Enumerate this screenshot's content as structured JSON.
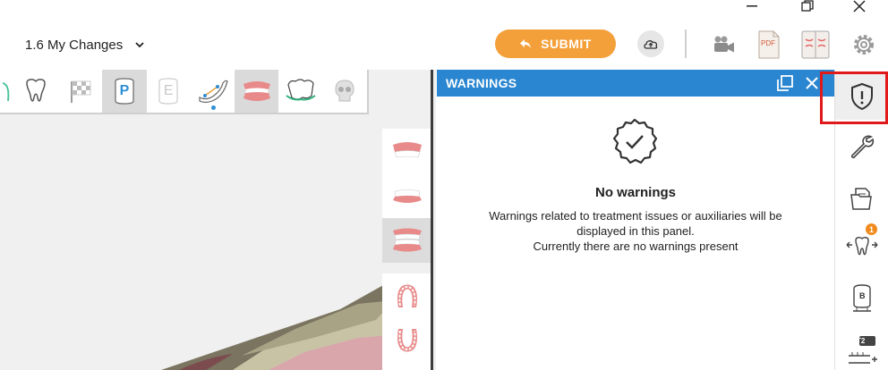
{
  "header": {
    "version_label": "1.6 My Changes",
    "submit_label": "SUBMIT",
    "pdf_label": "PDF"
  },
  "window_controls": [
    "minimize",
    "restore",
    "close"
  ],
  "toolbar": {
    "tools": [
      {
        "name": "tooth-icon",
        "active": false
      },
      {
        "name": "checkered-flag-icon",
        "active": false
      },
      {
        "name": "p-marker-icon",
        "label": "P",
        "active": true
      },
      {
        "name": "e-marker-icon",
        "label": "E",
        "active": false
      },
      {
        "name": "arch-ruler-icon",
        "active": false,
        "has_dot": true
      },
      {
        "name": "dentures-icon",
        "active": true
      },
      {
        "name": "aligner-icon",
        "active": false
      },
      {
        "name": "skull-icon",
        "active": false
      }
    ]
  },
  "side_tools": [
    {
      "name": "upper-jaw-view-icon",
      "active": false
    },
    {
      "name": "front-view-icon",
      "active": false
    },
    {
      "name": "both-jaws-view-icon",
      "active": true
    },
    {
      "name": "upper-occlusal-view-icon",
      "active": false
    },
    {
      "name": "lower-occlusal-view-icon",
      "active": false
    }
  ],
  "warnings_panel": {
    "title": "WARNINGS",
    "empty_title": "No warnings",
    "empty_line1": "Warnings related to treatment issues or auxiliaries will be displayed in this panel.",
    "empty_line2": "Currently there are no warnings present"
  },
  "right_sidebar": {
    "items": [
      {
        "name": "warnings-shield-icon",
        "active": true
      },
      {
        "name": "wrench-icon",
        "active": false
      },
      {
        "name": "documents-icon",
        "active": false
      },
      {
        "name": "tooth-movement-icon",
        "badge": "1",
        "active": false
      },
      {
        "name": "bracket-b-icon",
        "label": "B",
        "active": false
      },
      {
        "name": "t2-ruler-icon",
        "label": "T2",
        "active": false
      }
    ]
  },
  "colors": {
    "accent_blue": "#2a86d1",
    "submit_orange": "#f4a03a",
    "highlight_red": "#e0191b",
    "badge_orange": "#f08a1c"
  }
}
